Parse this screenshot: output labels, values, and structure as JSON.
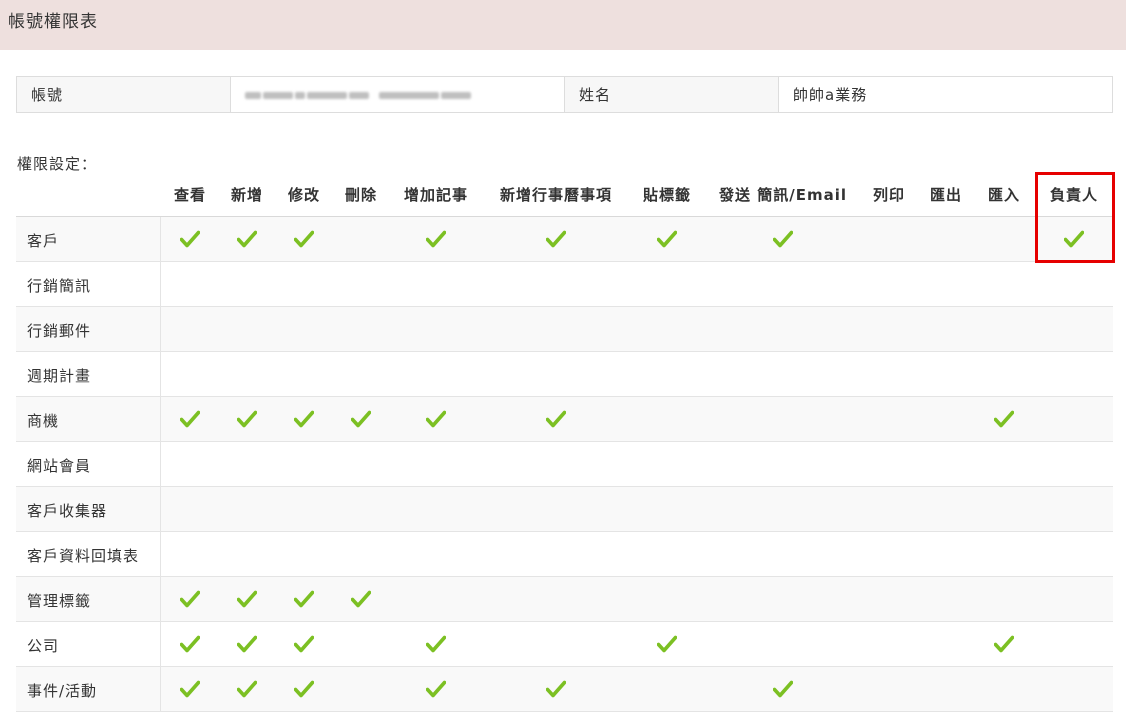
{
  "header": {
    "title": "帳號權限表"
  },
  "account_info": {
    "account_label": "帳號",
    "account_value": "",
    "name_label": "姓名",
    "name_value": "帥帥a業務"
  },
  "permissions": {
    "section_label": "權限設定：",
    "columns": [
      "查看",
      "新增",
      "修改",
      "刪除",
      "增加記事",
      "新增行事曆事項",
      "貼標籤",
      "發送 簡訊/Email",
      "列印",
      "匯出",
      "匯入",
      "負責人"
    ],
    "rows": [
      {
        "name": "客戶",
        "checks": [
          true,
          true,
          true,
          false,
          true,
          true,
          true,
          true,
          false,
          false,
          false,
          true
        ]
      },
      {
        "name": "行銷簡訊",
        "checks": [
          false,
          false,
          false,
          false,
          false,
          false,
          false,
          false,
          false,
          false,
          false,
          false
        ]
      },
      {
        "name": "行銷郵件",
        "checks": [
          false,
          false,
          false,
          false,
          false,
          false,
          false,
          false,
          false,
          false,
          false,
          false
        ]
      },
      {
        "name": "週期計畫",
        "checks": [
          false,
          false,
          false,
          false,
          false,
          false,
          false,
          false,
          false,
          false,
          false,
          false
        ]
      },
      {
        "name": "商機",
        "checks": [
          true,
          true,
          true,
          true,
          true,
          true,
          false,
          false,
          false,
          false,
          true,
          false
        ]
      },
      {
        "name": "網站會員",
        "checks": [
          false,
          false,
          false,
          false,
          false,
          false,
          false,
          false,
          false,
          false,
          false,
          false
        ]
      },
      {
        "name": "客戶收集器",
        "checks": [
          false,
          false,
          false,
          false,
          false,
          false,
          false,
          false,
          false,
          false,
          false,
          false
        ]
      },
      {
        "name": "客戶資料回填表",
        "checks": [
          false,
          false,
          false,
          false,
          false,
          false,
          false,
          false,
          false,
          false,
          false,
          false
        ]
      },
      {
        "name": "管理標籤",
        "checks": [
          true,
          true,
          true,
          true,
          false,
          false,
          false,
          false,
          false,
          false,
          false,
          false
        ]
      },
      {
        "name": "公司",
        "checks": [
          true,
          true,
          true,
          false,
          true,
          false,
          true,
          false,
          false,
          false,
          true,
          false
        ]
      },
      {
        "name": "事件/活動",
        "checks": [
          true,
          true,
          true,
          false,
          true,
          true,
          false,
          true,
          false,
          false,
          false,
          false
        ]
      }
    ]
  },
  "colors": {
    "header_bg": "#eee0de",
    "check": "#7cc023",
    "highlight": "#e60000"
  },
  "icons": {
    "check": "check-icon"
  },
  "highlight": {
    "column": "負責人"
  }
}
